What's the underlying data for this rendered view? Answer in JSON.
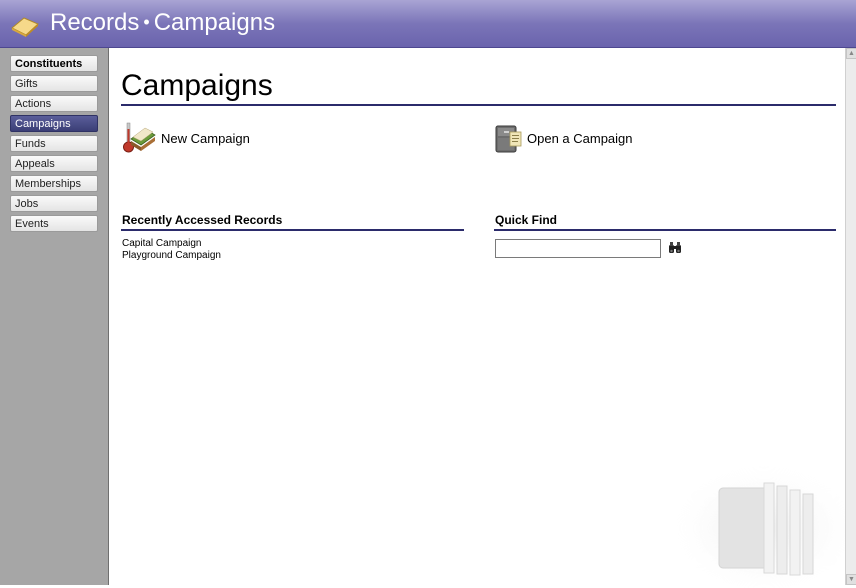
{
  "window": {
    "title_part1": "Records",
    "title_separator": "•",
    "title_part2": "Campaigns",
    "app_icon": "folder-icon"
  },
  "sidebar": {
    "items": [
      {
        "label": "Constituents",
        "state": "header"
      },
      {
        "label": "Gifts",
        "state": "normal"
      },
      {
        "label": "Actions",
        "state": "normal"
      },
      {
        "label": "Campaigns",
        "state": "active"
      },
      {
        "label": "Funds",
        "state": "normal"
      },
      {
        "label": "Appeals",
        "state": "normal"
      },
      {
        "label": "Memberships",
        "state": "normal"
      },
      {
        "label": "Jobs",
        "state": "normal"
      },
      {
        "label": "Events",
        "state": "normal"
      }
    ]
  },
  "main": {
    "page_title": "Campaigns",
    "actions": {
      "new": {
        "label": "New Campaign",
        "icon": "new-campaign-icon"
      },
      "open": {
        "label": "Open a Campaign",
        "icon": "open-campaign-icon"
      }
    },
    "recent": {
      "heading": "Recently Accessed Records",
      "items": [
        "Capital Campaign",
        "Playground Campaign"
      ]
    },
    "quick_find": {
      "heading": "Quick Find",
      "value": "",
      "placeholder": "",
      "search_icon": "binoculars-icon"
    }
  },
  "colors": {
    "titlebar": "#7b75b8",
    "active_nav": "#3b3e76",
    "rule": "#2b2b6b",
    "sidebar_bg": "#a6a6a6"
  }
}
